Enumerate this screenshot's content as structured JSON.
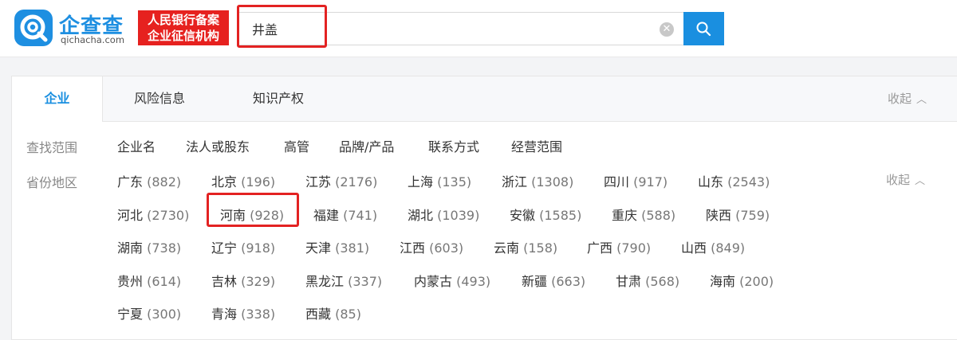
{
  "brand": {
    "title": "企查查",
    "subtitle": "qichacha.com",
    "badge_line1": "人民银行备案",
    "badge_line2": "企业征信机构"
  },
  "search": {
    "value": "井盖"
  },
  "tabs": [
    {
      "label": "企业",
      "active": true
    },
    {
      "label": "风险信息",
      "active": false
    },
    {
      "label": "知识产权",
      "active": false
    }
  ],
  "collapse_label": "收起",
  "scope": {
    "label": "查找范围",
    "items": [
      "企业名",
      "法人或股东",
      "高管",
      "品牌/产品",
      "联系方式",
      "经营范围"
    ]
  },
  "regions": {
    "label": "省份地区",
    "items": [
      {
        "name": "广东",
        "count": "(882)"
      },
      {
        "name": "北京",
        "count": "(196)"
      },
      {
        "name": "江苏",
        "count": "(2176)"
      },
      {
        "name": "上海",
        "count": "(135)"
      },
      {
        "name": "浙江",
        "count": "(1308)"
      },
      {
        "name": "四川",
        "count": "(917)"
      },
      {
        "name": "山东",
        "count": "(2543)"
      },
      {
        "name": "河北",
        "count": "(2730)"
      },
      {
        "name": "河南",
        "count": "(928)"
      },
      {
        "name": "福建",
        "count": "(741)"
      },
      {
        "name": "湖北",
        "count": "(1039)"
      },
      {
        "name": "安徽",
        "count": "(1585)"
      },
      {
        "name": "重庆",
        "count": "(588)"
      },
      {
        "name": "陕西",
        "count": "(759)"
      },
      {
        "name": "湖南",
        "count": "(738)"
      },
      {
        "name": "辽宁",
        "count": "(918)"
      },
      {
        "name": "天津",
        "count": "(381)"
      },
      {
        "name": "江西",
        "count": "(603)"
      },
      {
        "name": "云南",
        "count": "(158)"
      },
      {
        "name": "广西",
        "count": "(790)"
      },
      {
        "name": "山西",
        "count": "(849)"
      },
      {
        "name": "贵州",
        "count": "(614)"
      },
      {
        "name": "吉林",
        "count": "(329)"
      },
      {
        "name": "黑龙江",
        "count": "(337)"
      },
      {
        "name": "内蒙古",
        "count": "(493)"
      },
      {
        "name": "新疆",
        "count": "(663)"
      },
      {
        "name": "甘肃",
        "count": "(568)"
      },
      {
        "name": "海南",
        "count": "(200)"
      },
      {
        "name": "宁夏",
        "count": "(300)"
      },
      {
        "name": "青海",
        "count": "(338)"
      },
      {
        "name": "西藏",
        "count": "(85)"
      }
    ]
  },
  "colors": {
    "brand_blue": "#1a8fe0",
    "badge_red": "#e6211f",
    "highlight_red": "#e32222"
  },
  "icons": {
    "logo": "qichacha-logo-icon",
    "clear": "clear-icon",
    "search": "search-icon",
    "collapse": "chevron-up-icon"
  }
}
